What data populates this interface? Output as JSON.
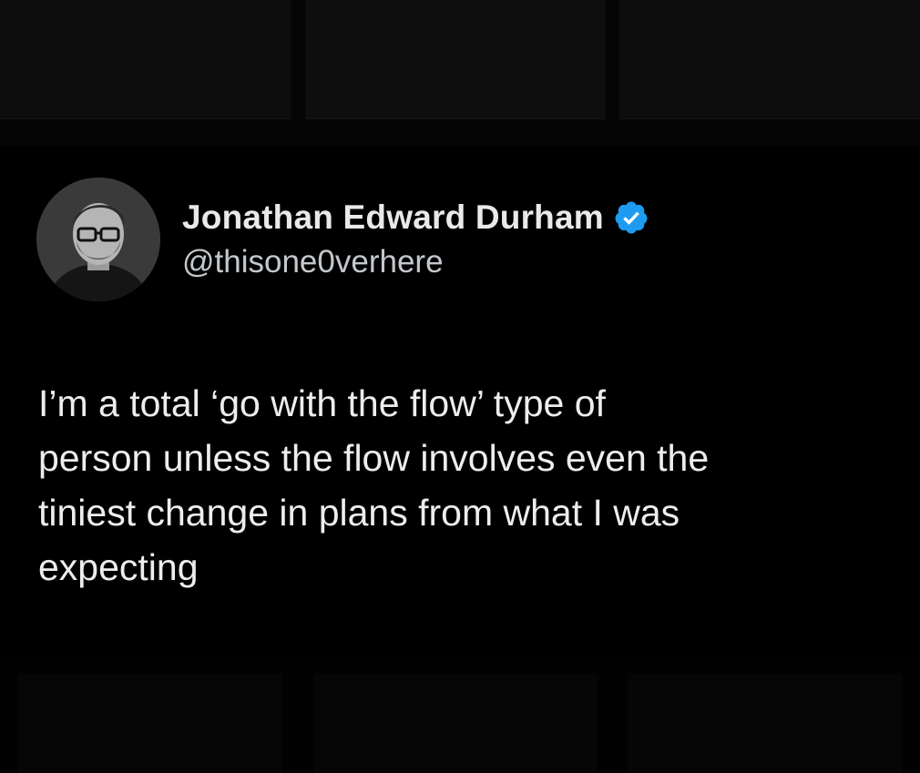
{
  "tweet": {
    "display_name": "Jonathan Edward Durham",
    "handle": "@thisone0verhere",
    "verified": true,
    "verified_color": "#1d9bf0",
    "text_lines": [
      "I’m a total ‘go with the flow’ type of",
      "person unless the flow involves even the",
      "tiniest change in plans from what I was",
      "expecting"
    ]
  },
  "icons": {
    "verified": "verified-badge-icon",
    "avatar": "profile-photo"
  },
  "colors": {
    "background": "#000000",
    "text": "#e7e9ea",
    "handle": "#c4c8cc"
  }
}
